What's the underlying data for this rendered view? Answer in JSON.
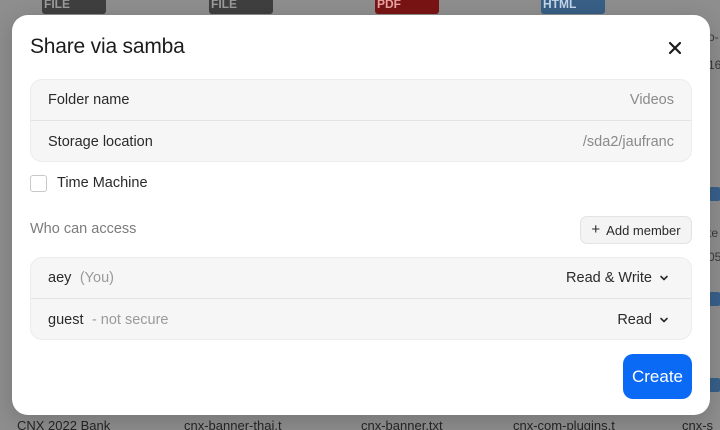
{
  "background": {
    "top_icons": [
      {
        "label": "FILE",
        "kind": "file"
      },
      {
        "label": "FILE",
        "kind": "file"
      },
      {
        "label": "PDF",
        "kind": "pdf"
      },
      {
        "label": "HTML",
        "kind": "html"
      }
    ],
    "bottom_files": [
      "CNX 2022 Bank",
      "cnx-banner-thai.t",
      "cnx-banner.txt",
      "cnx-com-plugins.t",
      "cnx-s"
    ],
    "side_fragments": [
      "o-",
      "16",
      "te",
      "05"
    ]
  },
  "modal": {
    "title": "Share via samba",
    "close_icon": "close-icon",
    "fields": [
      {
        "label": "Folder name",
        "value": "Videos"
      },
      {
        "label": "Storage location",
        "value": "/sda2/jaufranc"
      }
    ],
    "time_machine": {
      "label": "Time Machine",
      "checked": false
    },
    "access": {
      "label": "Who can access",
      "add_member_label": "Add member",
      "members": [
        {
          "name": "aey",
          "note": "(You)",
          "permission": "Read & Write"
        },
        {
          "name": "guest",
          "note": "- not secure",
          "permission": "Read"
        }
      ]
    },
    "create_label": "Create",
    "accent_color": "#0a6af5"
  }
}
